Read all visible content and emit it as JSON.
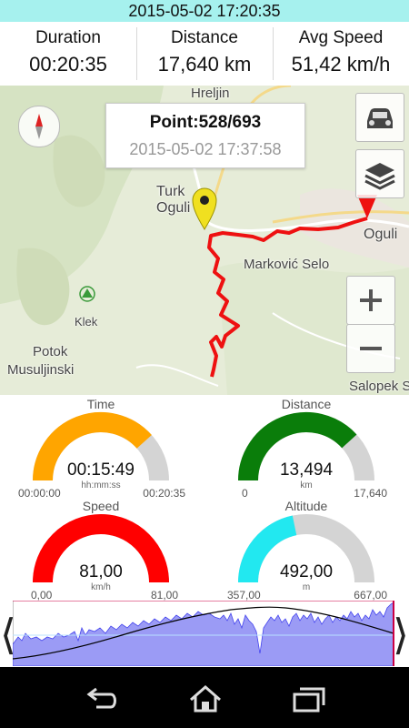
{
  "header": {
    "datetime": "2015-05-02 17:20:35"
  },
  "stats": [
    {
      "label": "Duration",
      "value": "00:20:35"
    },
    {
      "label": "Distance",
      "value": "17,640 km"
    },
    {
      "label": "Avg Speed",
      "value": "51,42 km/h"
    }
  ],
  "map": {
    "places": {
      "hreljin": "Hreljin",
      "turkovic": "Turk",
      "ogulin_small": "Oguli",
      "markovic": "Marković Selo",
      "ogulin": "Oguli",
      "klek": "Klek",
      "potok": "Potok",
      "musuljinski": "Musuljinski",
      "salopek": "Salopek S"
    },
    "popup": {
      "point": "Point:528/693",
      "time": "2015-05-02 17:37:58"
    },
    "route_color": "#ee1111"
  },
  "gauges": [
    {
      "title": "Time",
      "value": "00:15:49",
      "unit": "hh:mm:ss",
      "min": "00:00:00",
      "max": "00:20:35",
      "fraction": 0.768,
      "color": "#ffa500"
    },
    {
      "title": "Distance",
      "value": "13,494",
      "unit": "km",
      "min": "0",
      "max": "17,640",
      "fraction": 0.765,
      "color": "#0a7d0a"
    },
    {
      "title": "Speed",
      "value": "81,00",
      "unit": "km/h",
      "min": "0,00",
      "max": "81,00",
      "fraction": 1.0,
      "color": "#ff0000"
    },
    {
      "title": "Altitude",
      "value": "492,00",
      "unit": "m",
      "min": "357,00",
      "max": "667,00",
      "fraction": 0.435,
      "color": "#22e8f0"
    }
  ],
  "profile": {
    "fill_color": "#9b9bf5",
    "line_color": "#000000",
    "cursor_color": "#cc0044"
  }
}
